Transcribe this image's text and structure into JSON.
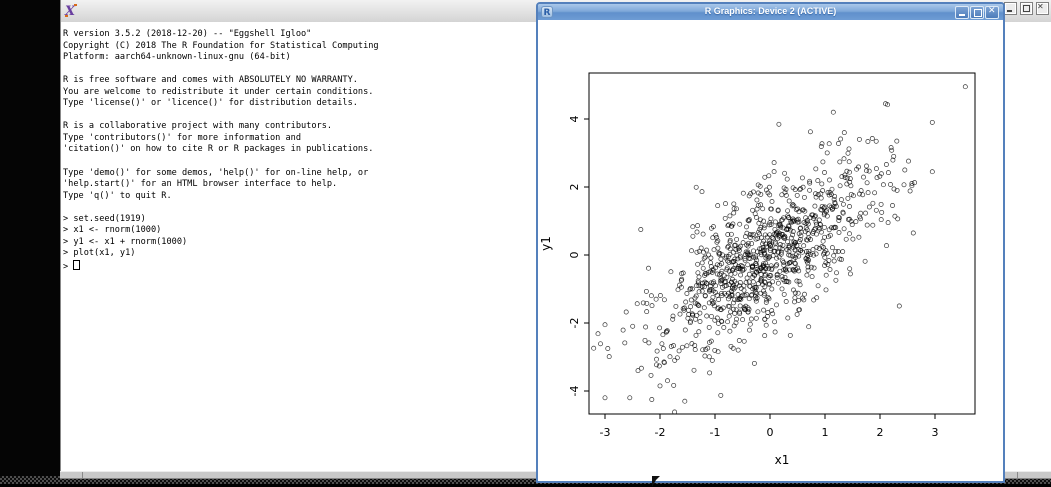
{
  "terminal": {
    "titlebar": {
      "icon": "x11-logo-icon"
    },
    "window_buttons": [
      "minimize",
      "maximize",
      "close"
    ],
    "lines": [
      "R version 3.5.2 (2018-12-20) -- \"Eggshell Igloo\"",
      "Copyright (C) 2018 The R Foundation for Statistical Computing",
      "Platform: aarch64-unknown-linux-gnu (64-bit)",
      "",
      "R is free software and comes with ABSOLUTELY NO WARRANTY.",
      "You are welcome to redistribute it under certain conditions.",
      "Type 'license()' or 'licence()' for distribution details.",
      "",
      "R is a collaborative project with many contributors.",
      "Type 'contributors()' for more information and",
      "'citation()' on how to cite R or R packages in publications.",
      "",
      "Type 'demo()' for some demos, 'help()' for on-line help, or",
      "'help.start()' for an HTML browser interface to help.",
      "Type 'q()' to quit R.",
      "",
      "> set.seed(1919)",
      "> x1 <- rnorm(1000)",
      "> y1 <- x1 + rnorm(1000)",
      "> plot(x1, y1)",
      "> "
    ],
    "cursor_style": "hollow-box"
  },
  "graphics_window": {
    "title": "R Graphics: Device 2 (ACTIVE)",
    "icon": "r-logo-icon",
    "window_buttons": [
      "minimize",
      "maximize",
      "close"
    ],
    "accent_color": "#5480bc",
    "titlebar_color": "#6f9fd6"
  },
  "chart_data": {
    "type": "scatter",
    "title": "",
    "xlabel": "x1",
    "ylabel": "y1",
    "x_ticks": [
      -3,
      -2,
      -1,
      0,
      1,
      2,
      3
    ],
    "y_ticks": [
      -4,
      -2,
      0,
      2,
      4
    ],
    "xlim": [
      -3.29,
      3.73
    ],
    "ylim": [
      -4.68,
      5.35
    ],
    "grid": false,
    "legend": "none",
    "marker": "open-circle",
    "n_points": 1000,
    "relationship": "positive linear correlation, y1 = x1 + standard normal noise",
    "source_commands": [
      "set.seed(1919)",
      "x1 <- rnorm(1000)",
      "y1 <- x1 + rnorm(1000)",
      "plot(x1, y1)"
    ],
    "generator": {
      "seed": 1919,
      "algorithm": "mulberry32-box-muller"
    },
    "notable_points": [
      [
        3.55,
        4.95
      ],
      [
        2.1,
        4.45
      ],
      [
        1.15,
        4.2
      ],
      [
        1.35,
        3.6
      ],
      [
        2.95,
        3.9
      ],
      [
        2.45,
        2.5
      ],
      [
        2.95,
        2.45
      ],
      [
        -2.35,
        0.75
      ],
      [
        -2.95,
        -2.75
      ],
      [
        -3.0,
        -2.05
      ],
      [
        2.35,
        -1.5
      ],
      [
        -1.05,
        -3.1
      ],
      [
        -3.0,
        -4.2
      ],
      [
        -2.55,
        -4.2
      ],
      [
        -2.15,
        -4.25
      ],
      [
        -1.55,
        -4.3
      ],
      [
        -2.0,
        -3.85
      ],
      [
        -2.4,
        -3.4
      ]
    ]
  }
}
